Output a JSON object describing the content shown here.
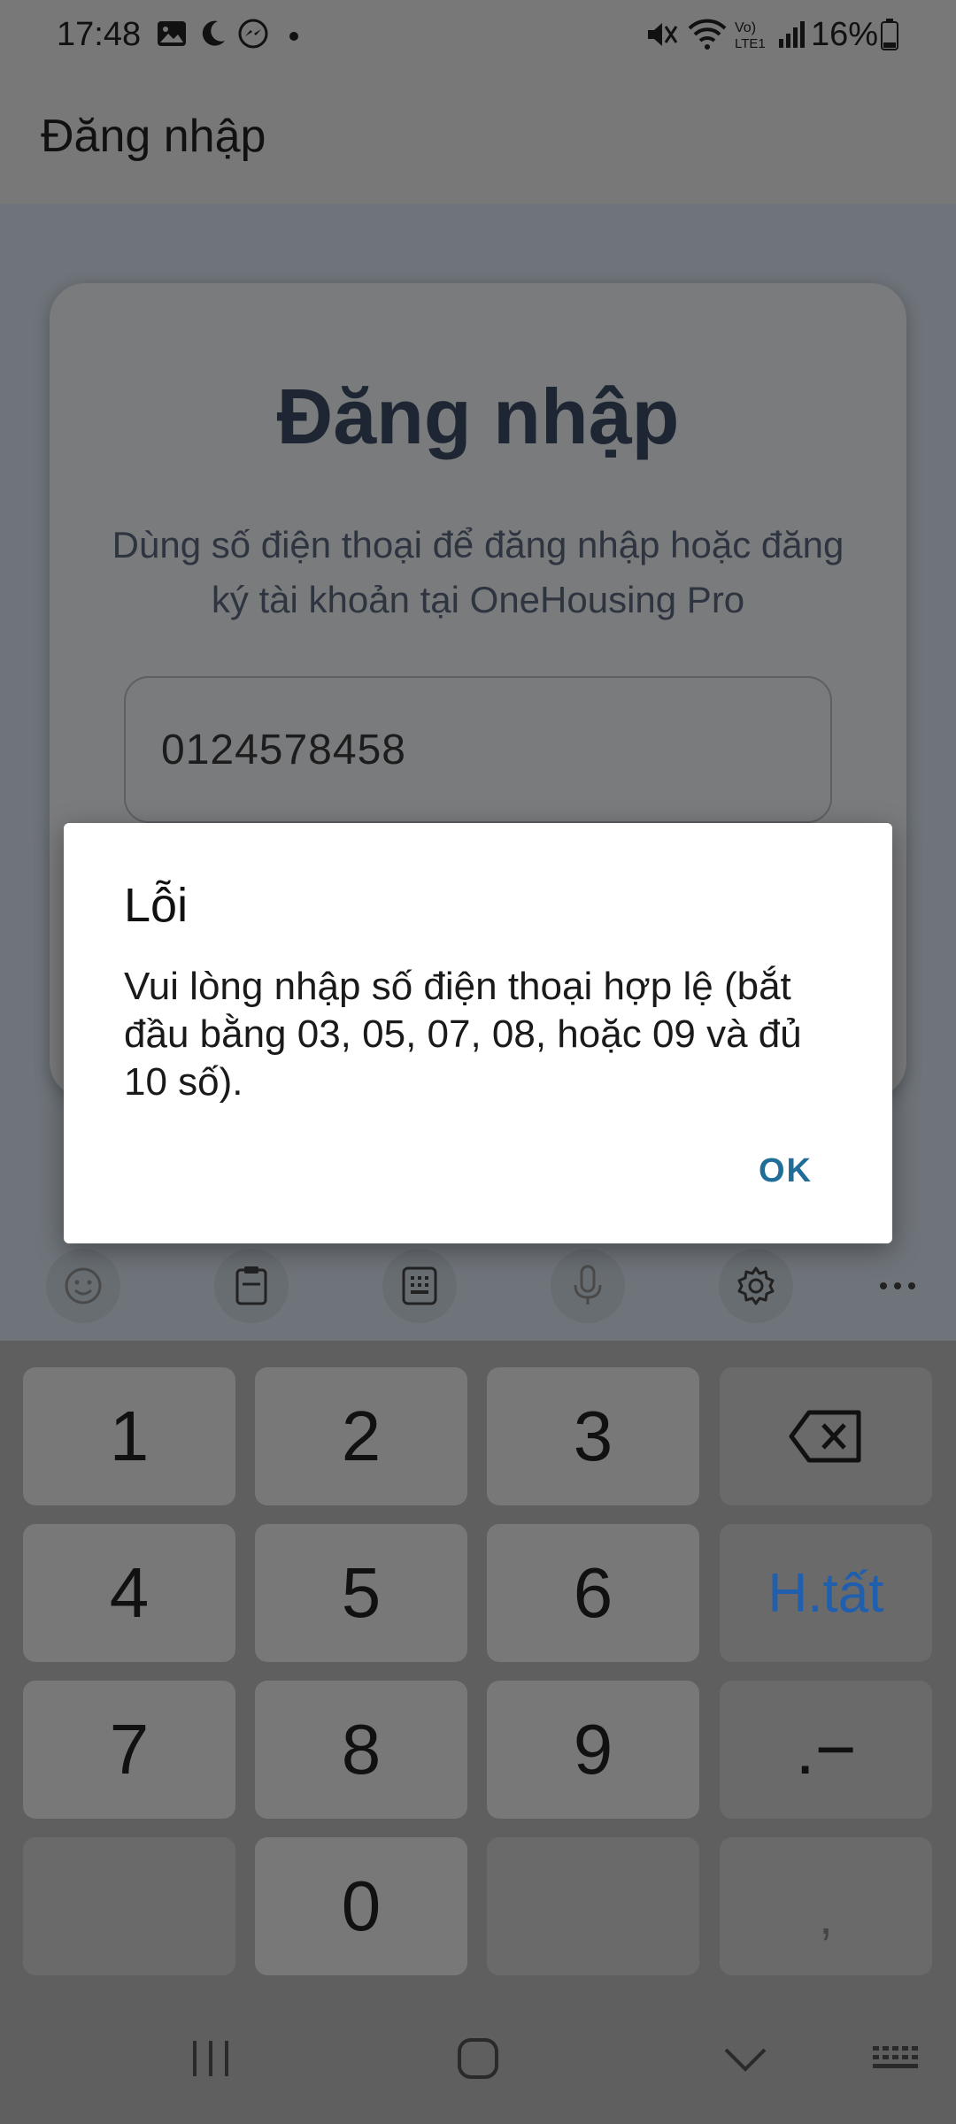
{
  "status_bar": {
    "time": "17:48",
    "battery": "16%"
  },
  "app_bar": {
    "title": "Đăng nhập"
  },
  "login": {
    "heading": "Đăng nhập",
    "description": "Dùng số điện thoại để đăng nhập hoặc đăng ký tài khoản tại OneHousing Pro",
    "phone_value": "0124578458"
  },
  "dialog": {
    "title": "Lỗi",
    "message": "Vui lòng nhập số điện thoại hợp lệ (bắt đầu bằng 03, 05, 07, 08, hoặc 09 và đủ 10 số).",
    "ok_label": "OK"
  },
  "keyboard": {
    "keys": {
      "k1": "1",
      "k2": "2",
      "k3": "3",
      "k4": "4",
      "k5": "5",
      "k6": "6",
      "k7": "7",
      "k8": "8",
      "k9": "9",
      "k0": "0",
      "done": "H.tất",
      "dot_dash": ".−",
      "comma": ","
    },
    "toolbar_icons": [
      "emoji-icon",
      "clipboard-icon",
      "keypad-icon",
      "mic-icon",
      "settings-icon",
      "more-icon"
    ]
  },
  "colors": {
    "accent_ok": "#1f6e99",
    "done_key": "#1f5fae",
    "heading": "#1e2633"
  }
}
